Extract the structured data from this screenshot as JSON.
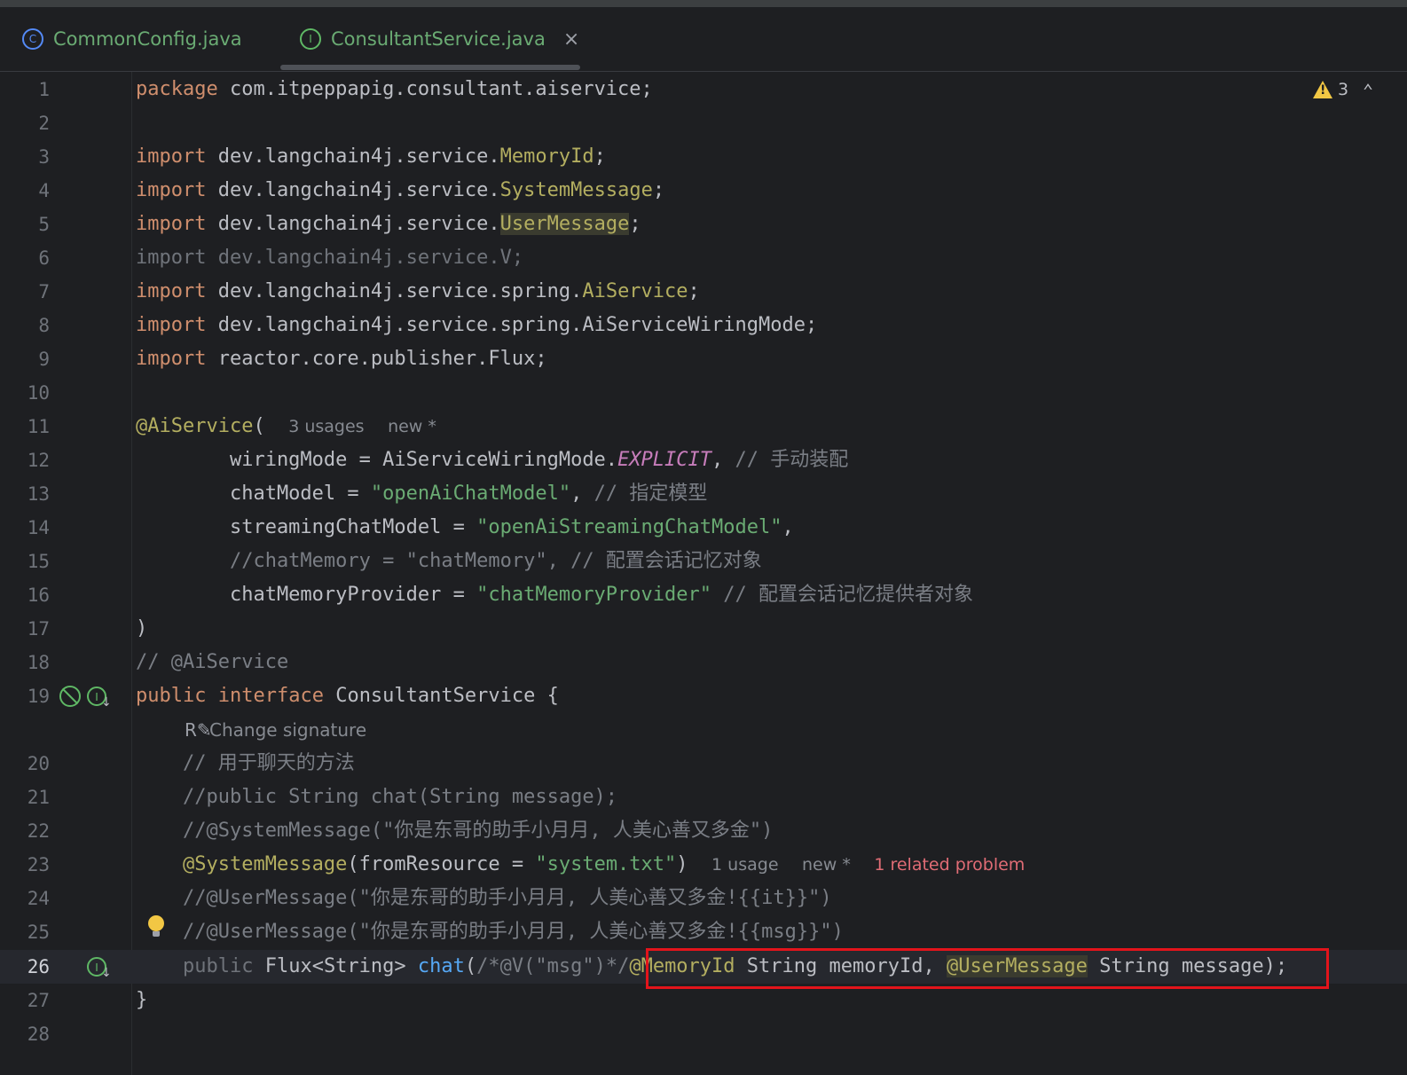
{
  "tabs": [
    {
      "label": "CommonConfig.java",
      "icon": "class-icon"
    },
    {
      "label": "ConsultantService.java",
      "icon": "interface-icon",
      "active": true
    }
  ],
  "warnings": {
    "count": "3"
  },
  "lines": {
    "l1": {
      "num": "1"
    },
    "l2": {
      "num": "2"
    },
    "l3": {
      "num": "3"
    },
    "l4": {
      "num": "4"
    },
    "l5": {
      "num": "5"
    },
    "l6": {
      "num": "6"
    },
    "l7": {
      "num": "7"
    },
    "l8": {
      "num": "8"
    },
    "l9": {
      "num": "9"
    },
    "l10": {
      "num": "10"
    },
    "l11": {
      "num": "11"
    },
    "l12": {
      "num": "12"
    },
    "l13": {
      "num": "13"
    },
    "l14": {
      "num": "14"
    },
    "l15": {
      "num": "15"
    },
    "l16": {
      "num": "16"
    },
    "l17": {
      "num": "17"
    },
    "l18": {
      "num": "18"
    },
    "l19": {
      "num": "19"
    },
    "l20": {
      "num": "20"
    },
    "l21": {
      "num": "21"
    },
    "l22": {
      "num": "22"
    },
    "l23": {
      "num": "23"
    },
    "l24": {
      "num": "24"
    },
    "l25": {
      "num": "25"
    },
    "l26": {
      "num": "26"
    },
    "l27": {
      "num": "27"
    },
    "l28": {
      "num": "28"
    }
  },
  "code": {
    "l1": {
      "kw": "package",
      "rest": " com.itpeppapig.consultant.aiservice;"
    },
    "l3": {
      "kw": "import",
      "pkg": " dev.langchain4j.service.",
      "cls": "MemoryId",
      "end": ";"
    },
    "l4": {
      "kw": "import",
      "pkg": " dev.langchain4j.service.",
      "cls": "SystemMessage",
      "end": ";"
    },
    "l5": {
      "kw": "import",
      "pkg": " dev.langchain4j.service.",
      "cls": "UserMessage",
      "end": ";"
    },
    "l6": {
      "text": "import dev.langchain4j.service.V;"
    },
    "l7": {
      "kw": "import",
      "pkg": " dev.langchain4j.service.spring.",
      "cls": "AiService",
      "end": ";"
    },
    "l8": {
      "kw": "import",
      "rest": " dev.langchain4j.service.spring.AiServiceWiringMode;"
    },
    "l9": {
      "kw": "import",
      "rest": " reactor.core.publisher.Flux;"
    },
    "l11": {
      "ann": "@AiService",
      "paren": "(",
      "hint_usages": "3 usages",
      "hint_new": "new *"
    },
    "l12": {
      "a": "        wiringMode = AiServiceWiringMode.",
      "const": "EXPLICIT",
      "b": ", ",
      "comment": "// 手动装配"
    },
    "l13": {
      "a": "        chatModel = ",
      "str": "\"openAiChatModel\"",
      "b": ", ",
      "comment": "// 指定模型"
    },
    "l14": {
      "a": "        streamingChatModel = ",
      "str": "\"openAiStreamingChatModel\"",
      "b": ","
    },
    "l15": {
      "comment": "        //chatMemory = \"chatMemory\", // 配置会话记忆对象"
    },
    "l16": {
      "a": "        chatMemoryProvider = ",
      "str": "\"chatMemoryProvider\"",
      "b": " ",
      "comment": "// 配置会话记忆提供者对象"
    },
    "l17": {
      "text": ")"
    },
    "l18": {
      "comment": "// @AiService"
    },
    "l19": {
      "kw1": "public",
      "kw2": "interface",
      "rest": " ConsultantService {"
    },
    "change_signature": "Change signature",
    "l20": {
      "comment": "    // 用于聊天的方法"
    },
    "l21": {
      "comment": "    //public String chat(String message);"
    },
    "l22": {
      "comment": "    //@SystemMessage(\"你是东哥的助手小月月, 人美心善又多金\")"
    },
    "l23": {
      "ann": "@SystemMessage",
      "a": "(fromResource = ",
      "str": "\"system.txt\"",
      "b": ")",
      "hint_usage": "1 usage",
      "hint_new": "new *",
      "hint_problem": "1 related problem"
    },
    "l24": {
      "comment": "    //@UserMessage(\"你是东哥的助手小月月, 人美心善又多金!{{it}}\")"
    },
    "l25": {
      "comment": "    //@UserMessage(\"你是东哥的助手小月月, 人美心善又多金!{{msg}}\")"
    },
    "l26": {
      "kw": "public",
      "a": " Flux<String> ",
      "fn": "chat",
      "b": "(",
      "cm": "/*@V(\"msg\")*/",
      "ann1": "@MemoryId",
      "c": " String memoryId, ",
      "ann2": "@UserMessage",
      "d": " String message);"
    },
    "l27": {
      "text": "}"
    }
  }
}
